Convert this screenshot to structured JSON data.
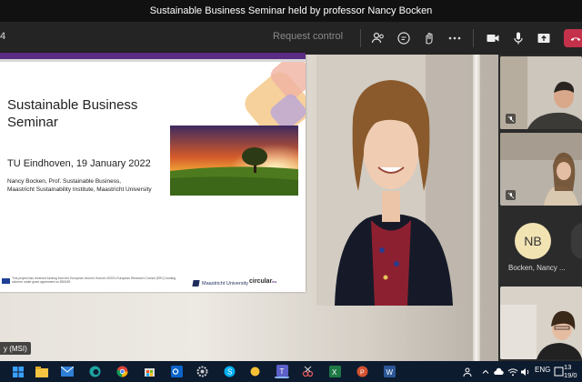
{
  "window": {
    "title": "Sustainable Business Seminar held by professor Nancy Bocken"
  },
  "toolbar": {
    "left_fragment": "4",
    "request_control_label": "Request control"
  },
  "slide": {
    "title": "Sustainable Business Seminar",
    "date_line": "TU Eindhoven, 19 January 2022",
    "author_line1": "Nancy Bocken, Prof. Sustainable Business,",
    "author_line2": "Maastricht Sustainability Institute, Maastricht University",
    "eu_notice": "This project has received funding from the European Union's Horizon 2020's European Research Council (ERC) funding scheme under grant agreement no 850159",
    "logo_um": "Maastricht University",
    "logo_circular": "circular",
    "logo_circular_suffix": "eu"
  },
  "presenter_label": "y (MSI)",
  "participants": [
    {
      "name": "Bocken, Nancy ...",
      "initials": "NB"
    }
  ],
  "taskbar": {
    "lang": "ENG",
    "time": "13",
    "date": "19/0"
  },
  "colors": {
    "accent_purple": "#5b2c83",
    "hangup_red": "#c4314b",
    "avatar_bg": "#f2e3b3"
  }
}
